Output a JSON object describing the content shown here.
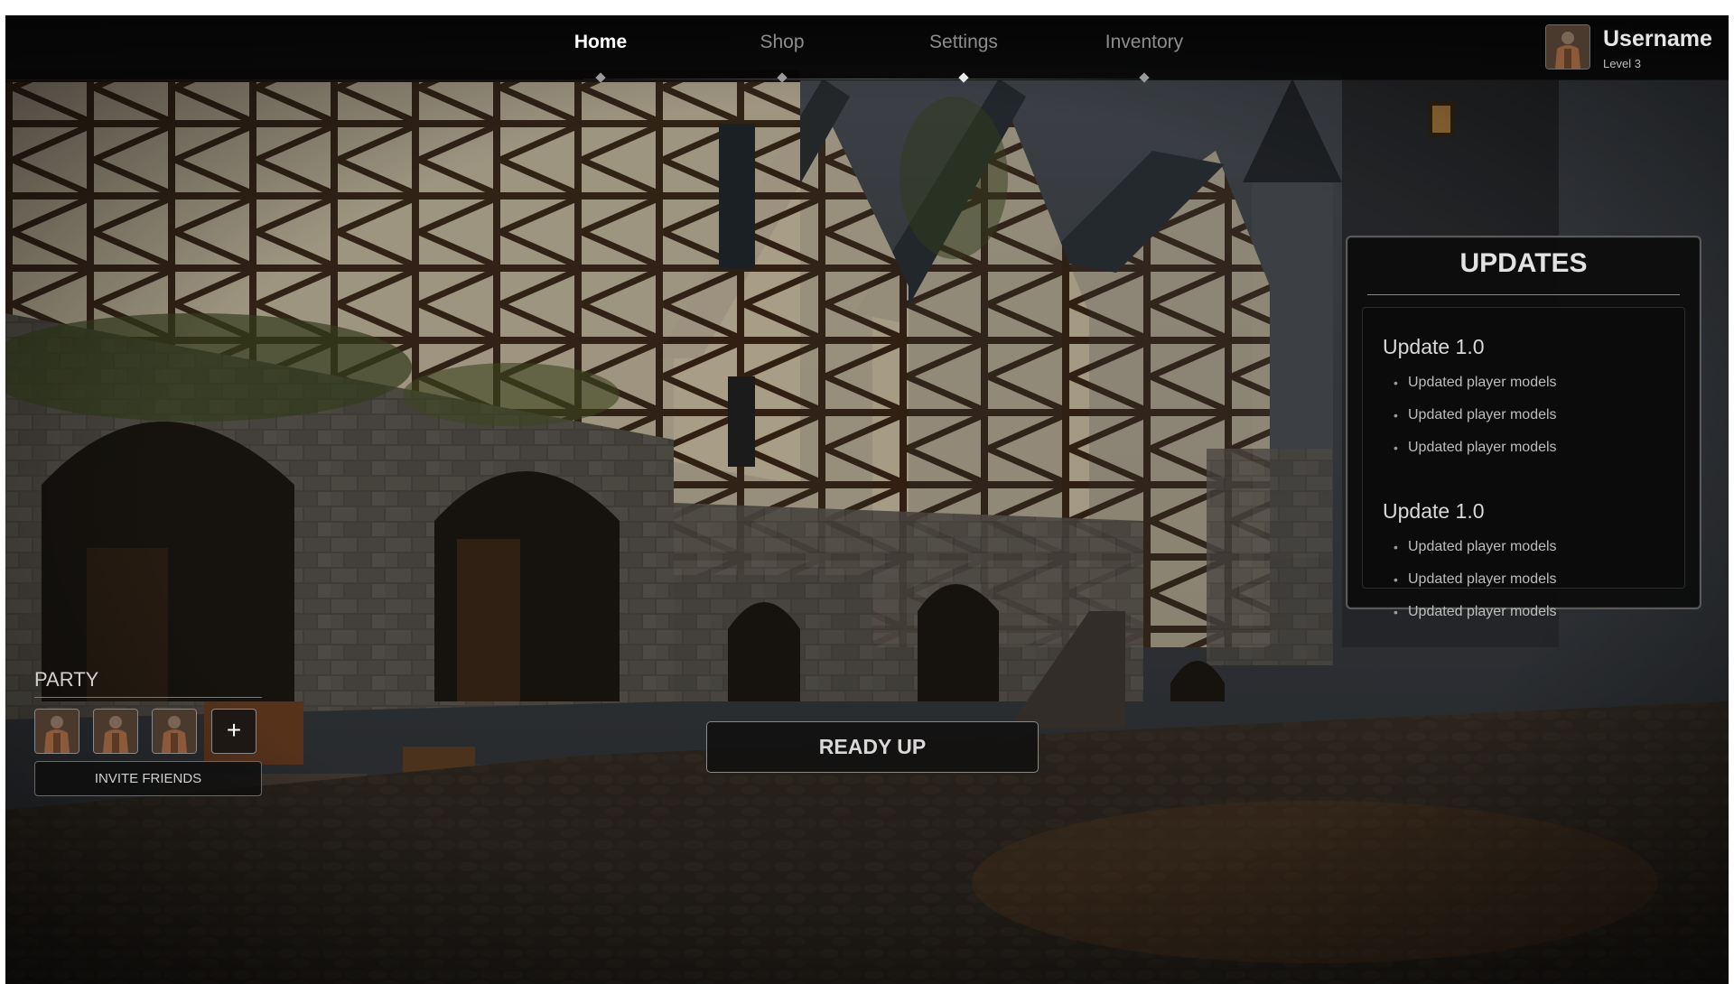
{
  "nav": {
    "items": [
      {
        "label": "Home",
        "active": true
      },
      {
        "label": "Shop",
        "active": false
      },
      {
        "label": "Settings",
        "active": false
      },
      {
        "label": "Inventory",
        "active": false
      }
    ]
  },
  "profile": {
    "username": "Username",
    "level": "Level 3"
  },
  "updates": {
    "title": "UPDATES",
    "blocks": [
      {
        "heading": "Update 1.0",
        "items": [
          "Updated player models",
          "Updated player models",
          "Updated player models"
        ]
      },
      {
        "heading": "Update 1.0",
        "items": [
          "Updated player models",
          "Updated player models",
          "Updated player models"
        ]
      }
    ]
  },
  "party": {
    "title": "PARTY",
    "add_label": "+",
    "invite_label": "INVITE FRIENDS"
  },
  "ready_label": "READY UP",
  "colors": {
    "panel_bg": "#0c0c0c",
    "panel_border": "#5a5a5a",
    "text_primary": "#e6e6e6",
    "text_muted": "#8d8d8d"
  }
}
